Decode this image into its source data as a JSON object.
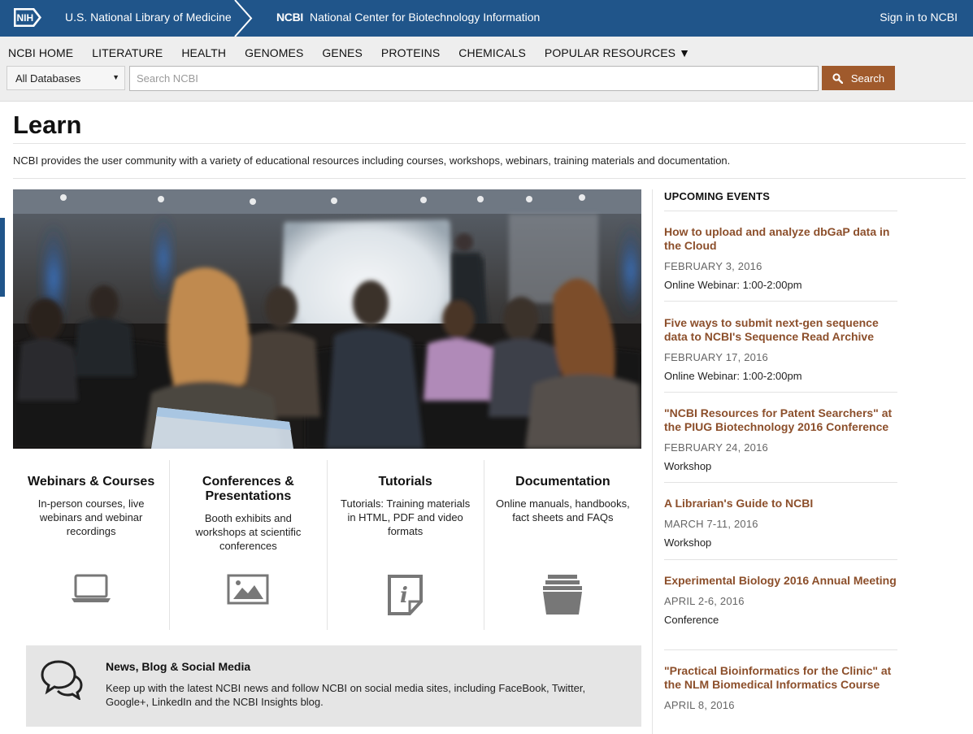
{
  "header": {
    "nih_logo": "NIH",
    "nlm_link": "U.S. National Library of Medicine",
    "ncbi_abbr": "NCBI",
    "ncbi_full": "National Center for Biotechnology Information",
    "sign_in": "Sign in to NCBI",
    "bar_color": "#20558a"
  },
  "nav": {
    "items": [
      {
        "label": "NCBI HOME"
      },
      {
        "label": "LITERATURE"
      },
      {
        "label": "HEALTH"
      },
      {
        "label": "GENOMES"
      },
      {
        "label": "GENES"
      },
      {
        "label": "PROTEINS"
      },
      {
        "label": "CHEMICALS"
      },
      {
        "label": "POPULAR RESOURCES ▼"
      }
    ]
  },
  "search": {
    "database_selected": "All Databases",
    "placeholder": "Search NCBI",
    "value": "",
    "button_label": "Search",
    "button_icon": "magnifier-icon",
    "button_color": "#a05a2c"
  },
  "page": {
    "title": "Learn",
    "intro": "NCBI provides the user community with a variety of educational resources including courses, workshops, webinars, training materials and documentation."
  },
  "features": [
    {
      "title": "Webinars & Courses",
      "desc": "In-person courses, live webinars and webinar recordings",
      "icon": "laptop-icon"
    },
    {
      "title": "Conferences & Presentations",
      "desc": "Booth exhibits and workshops at scientific conferences",
      "icon": "picture-icon"
    },
    {
      "title": "Tutorials",
      "desc": "Tutorials: Training materials in HTML, PDF and video formats",
      "icon": "info-document-icon"
    },
    {
      "title": "Documentation",
      "desc": "Online manuals, handbooks, fact sheets and FAQs",
      "icon": "document-stack-icon"
    }
  ],
  "news": {
    "title": "News, Blog & Social Media",
    "text": "Keep up with the latest NCBI news and follow NCBI on social media sites, including FaceBook, Twitter, Google+, LinkedIn and the NCBI Insights blog.",
    "icon": "speech-bubbles-icon"
  },
  "events": {
    "heading": "UPCOMING EVENTS",
    "link_color": "#8c4f2b",
    "items": [
      {
        "title": "How to upload and analyze dbGaP data in the Cloud",
        "date": "FEBRUARY 3, 2016",
        "type": "Online Webinar: 1:00-2:00pm"
      },
      {
        "title": "Five ways to submit next-gen sequence data to NCBI's Sequence Read Archive",
        "date": "FEBRUARY 17, 2016",
        "type": "Online Webinar: 1:00-2:00pm"
      },
      {
        "title": "\"NCBI Resources for Patent Searchers\" at the PIUG Biotechnology 2016 Conference",
        "date": "FEBRUARY 24, 2016",
        "type": "Workshop"
      },
      {
        "title": "A Librarian's Guide to NCBI",
        "date": "MARCH 7-11, 2016",
        "type": "Workshop"
      },
      {
        "title": "Experimental Biology 2016 Annual Meeting",
        "date": "APRIL 2-6, 2016",
        "type": "Conference"
      },
      {
        "title": "\"Practical Bioinformatics for the Clinic\" at the NLM Biomedical Informatics Course",
        "date": "APRIL 8, 2016",
        "type": ""
      }
    ]
  }
}
